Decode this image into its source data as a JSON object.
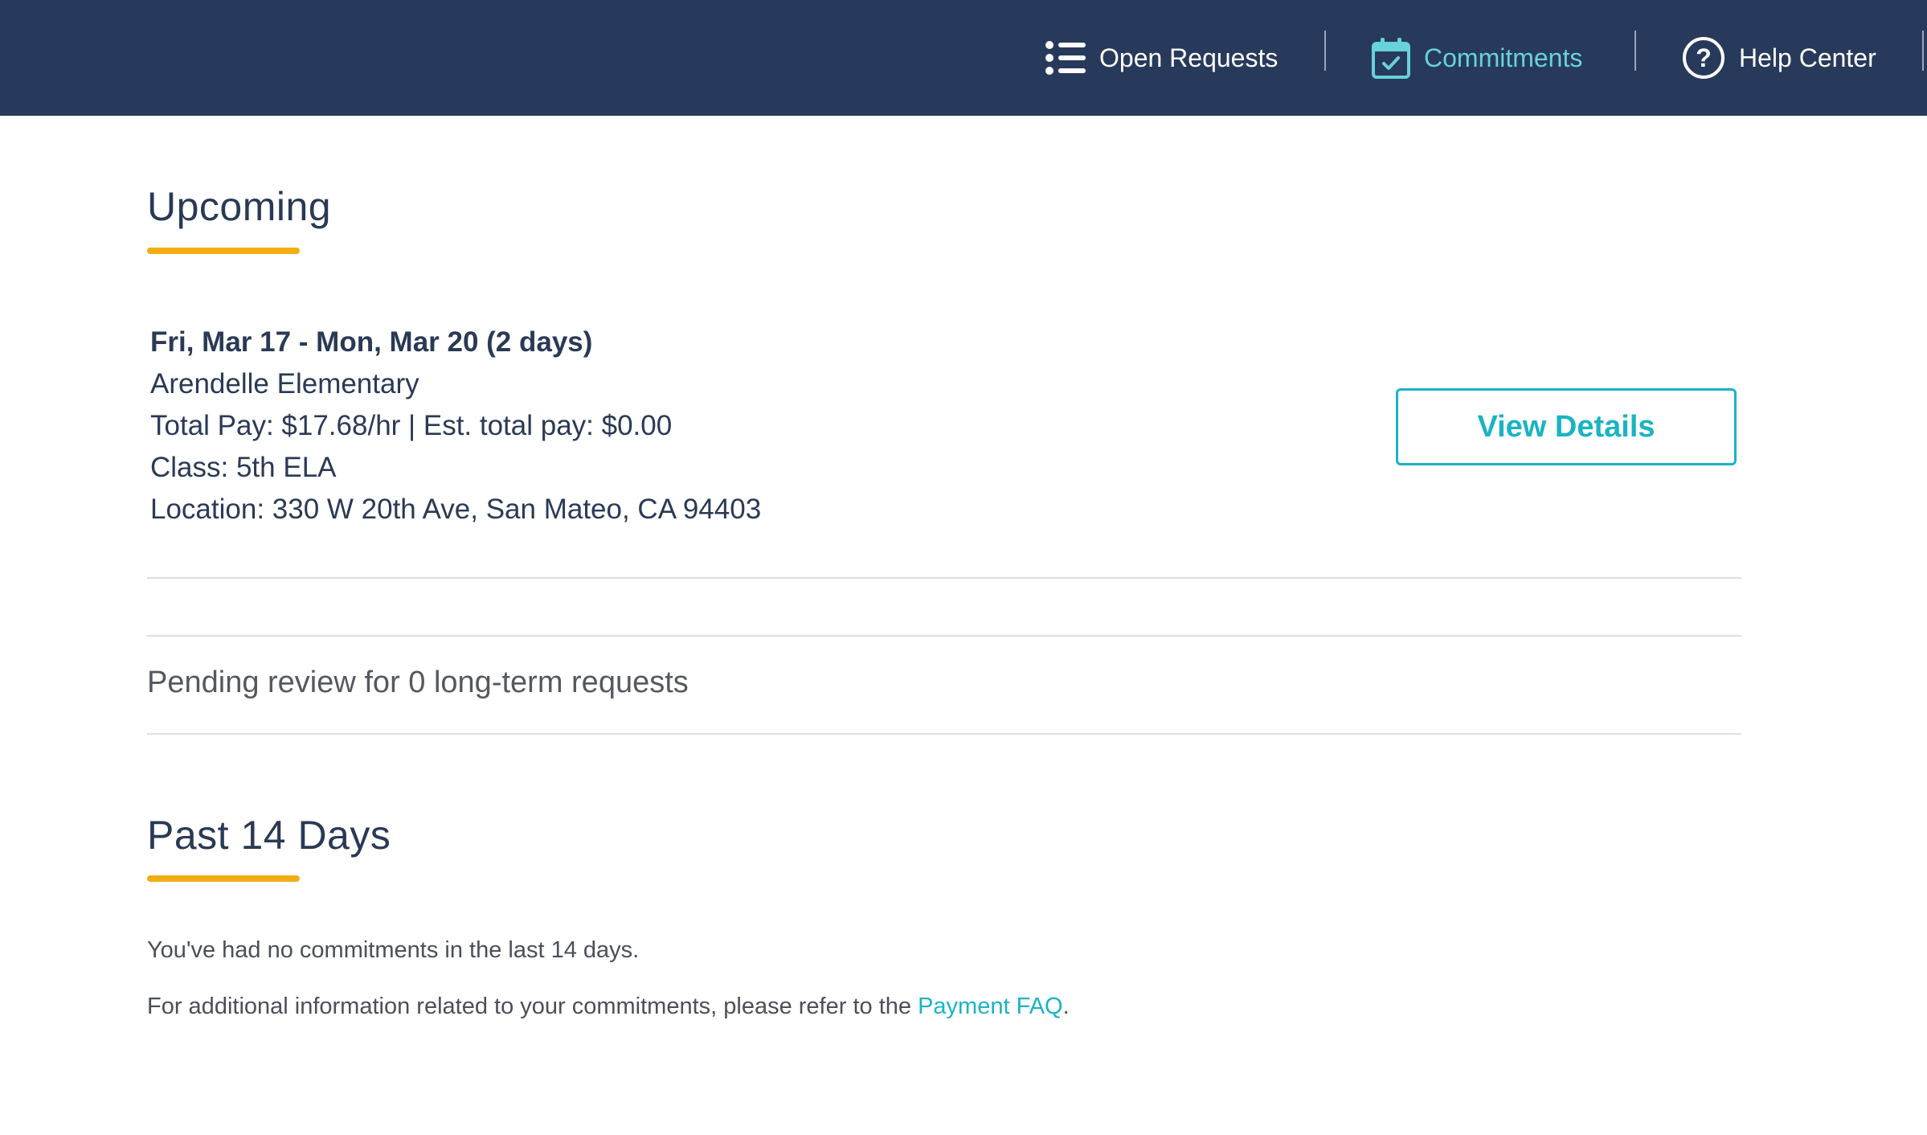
{
  "nav": {
    "open_requests": {
      "label": "Open Requests",
      "icon": "list-icon"
    },
    "commitments": {
      "label": "Commitments",
      "icon": "calendar-check-icon",
      "active": true
    },
    "help_center": {
      "label": "Help Center",
      "icon": "question-circle-icon"
    }
  },
  "upcoming": {
    "title": "Upcoming",
    "items": [
      {
        "dates": "Fri, Mar 17 - Mon, Mar 20 (2 days)",
        "school": "Arendelle Elementary",
        "pay": "Total Pay: $17.68/hr | Est. total pay: $0.00",
        "class": "Class: 5th ELA",
        "location": "Location: 330 W 20th Ave, San Mateo, CA 94403",
        "button_label": "View Details"
      }
    ]
  },
  "pending": {
    "text": "Pending review for 0 long-term requests"
  },
  "past": {
    "title": "Past 14 Days",
    "empty_text": "You've had no commitments in the last 14 days.",
    "faq_prefix": "For additional information related to your commitments, please refer to the ",
    "faq_link": "Payment FAQ",
    "faq_suffix": "."
  },
  "colors": {
    "header_bg": "#283a5b",
    "accent": "#1bb3c4",
    "active_nav": "#67d1dc",
    "underline": "#f3ad13",
    "text_primary": "#2a3a55"
  }
}
